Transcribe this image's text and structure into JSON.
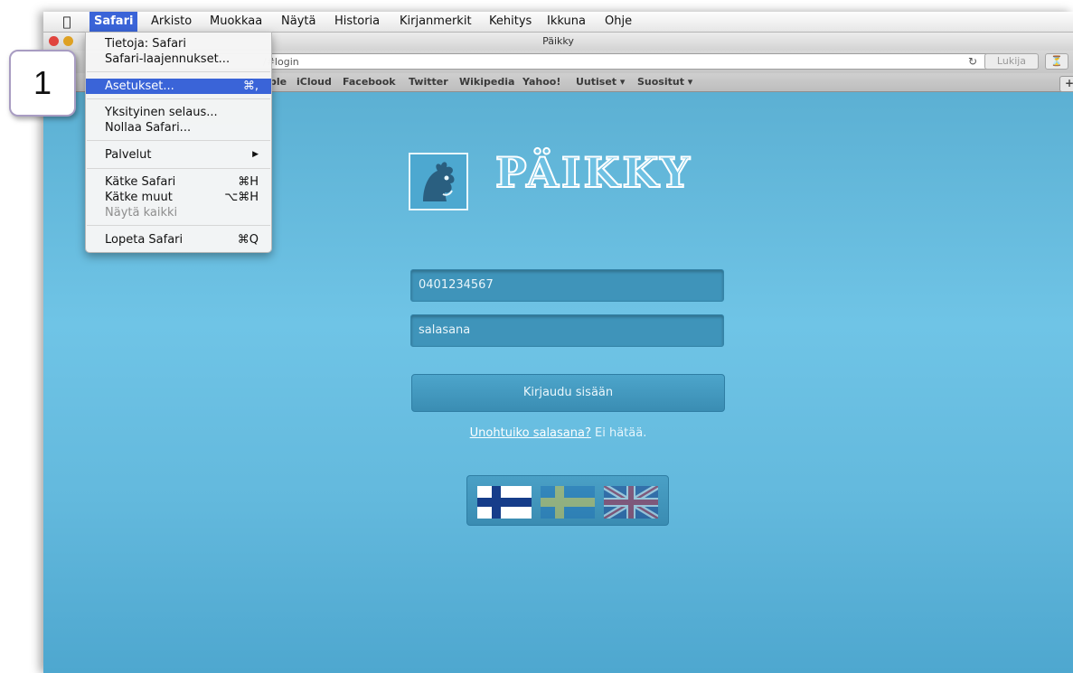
{
  "menubar": {
    "apple_icon": "apple-logo-icon",
    "items": [
      "Safari",
      "Arkisto",
      "Muokkaa",
      "Näytä",
      "Historia",
      "Kirjanmerkit",
      "Kehitys",
      "Ikkuna",
      "Ohje"
    ],
    "active": "Safari"
  },
  "window": {
    "title": "Päikky",
    "url": "/#login",
    "reader_label": "Lukija"
  },
  "bookmarks": [
    "ple",
    "iCloud",
    "Facebook",
    "Twitter",
    "Wikipedia",
    "Yahoo!",
    "Uutiset ▾",
    "Suositut ▾"
  ],
  "safari_menu": {
    "about": "Tietoja: Safari",
    "extensions": "Safari-laajennukset...",
    "preferences": "Asetukset...",
    "preferences_shortcut": "⌘,",
    "private": "Yksityinen selaus...",
    "reset": "Nollaa Safari...",
    "services": "Palvelut",
    "services_arrow": "▶",
    "hide": "Kätke Safari",
    "hide_shortcut": "⌘H",
    "hide_others": "Kätke muut",
    "hide_others_shortcut": "⌥⌘H",
    "show_all": "Näytä kaikki",
    "quit": "Lopeta Safari",
    "quit_shortcut": "⌘Q"
  },
  "callout": {
    "number": "1"
  },
  "login": {
    "logo_text": "PÄIKKY",
    "phone_value": "0401234567",
    "password_placeholder": "salasana",
    "submit_label": "Kirjaudu sisään",
    "forgot_link": "Unohtuiko salasana?",
    "forgot_suffix": " Ei hätää.",
    "languages": [
      "finnish-flag-icon",
      "swedish-flag-icon",
      "uk-flag-icon"
    ]
  },
  "colors": {
    "menu_highlight": "#3a64d8",
    "page_background": "#6fc4e6",
    "field_background": "#3f94ba"
  }
}
